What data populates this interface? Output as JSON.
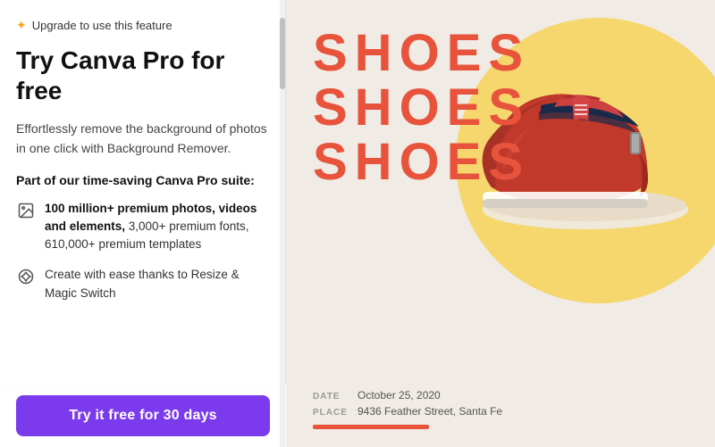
{
  "left": {
    "upgrade_label": "Upgrade to use this feature",
    "star_icon": "✦",
    "title": "Try Canva Pro for free",
    "description": "Effortlessly remove the background of photos in one click with Background Remover.",
    "section_label": "Part of our time-saving Canva Pro suite:",
    "features": [
      {
        "text_html": "100 million+ premium photos, videos and elements, 3,000+ premium fonts, 610,000+ premium templates",
        "bold_part": "100 million+ premium photos, videos and elements,",
        "icon_type": "image"
      },
      {
        "text_html": "Create with ease thanks to Resize & Magic Switch",
        "bold_part": "",
        "icon_type": "sparkle"
      }
    ],
    "cta_label": "Try it free for 30 days"
  },
  "right": {
    "shoes_lines": [
      "SHOES",
      "SHOES",
      "SHOES"
    ],
    "date_label": "DATE",
    "date_value": "October 25, 2020",
    "place_label": "PLACE",
    "place_value": "9436 Feather Street, Santa Fe"
  }
}
